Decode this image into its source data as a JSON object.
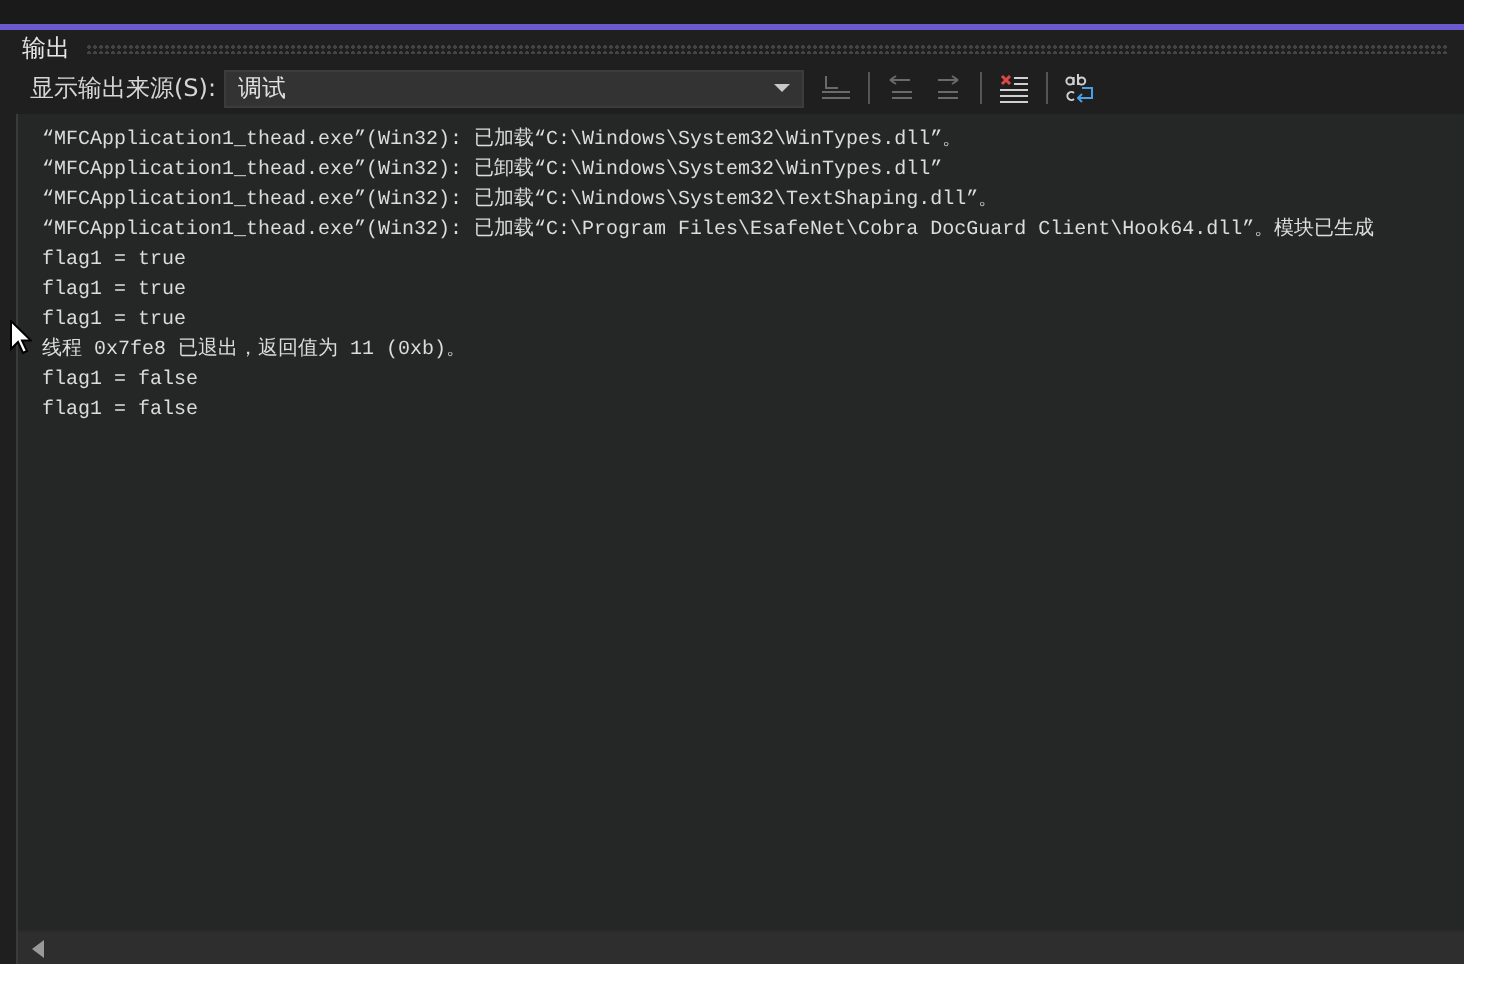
{
  "panel": {
    "title": "输出"
  },
  "toolbar": {
    "source_label": "显示输出来源(S):",
    "source_value": "调试",
    "buttons": [
      {
        "kind": "find-source",
        "disabled": true
      },
      {
        "kind": "prev-message",
        "disabled": true
      },
      {
        "kind": "next-message",
        "disabled": true
      },
      {
        "kind": "clear-all",
        "disabled": false
      },
      {
        "kind": "word-wrap",
        "disabled": false
      }
    ]
  },
  "output_lines": [
    "“MFCApplication1_thead.exe”(Win32): 已加载“C:\\Windows\\System32\\WinTypes.dll”。",
    "“MFCApplication1_thead.exe”(Win32): 已卸载“C:\\Windows\\System32\\WinTypes.dll”",
    "“MFCApplication1_thead.exe”(Win32): 已加载“C:\\Windows\\System32\\TextShaping.dll”。",
    "“MFCApplication1_thead.exe”(Win32): 已加载“C:\\Program Files\\EsafeNet\\Cobra DocGuard Client\\Hook64.dll”。模块已生成",
    "flag1 = true",
    "flag1 = true",
    "flag1 = true",
    "线程 0x7fe8 已退出，返回值为 11 (0xb)。",
    "flag1 = false",
    "flag1 = false"
  ]
}
